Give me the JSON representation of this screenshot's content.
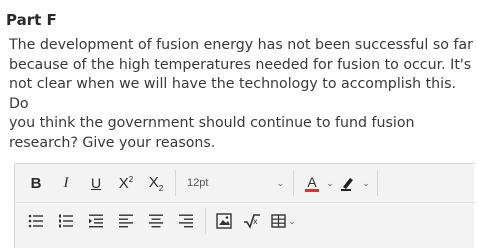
{
  "heading": "Part F",
  "question_lines": [
    "The development of fusion energy has not been successful so far",
    "because of the high temperatures needed for fusion to occur. It's",
    "not clear when we will have the technology to accomplish this. Do",
    "you think the government should continue to fund fusion",
    "research? Give your reasons."
  ],
  "toolbar": {
    "bold_label": "B",
    "italic_label": "I",
    "underline_label": "U",
    "superscript_label": "X",
    "superscript_mark": "2",
    "subscript_label": "X",
    "subscript_mark": "2",
    "font_size": "12pt",
    "text_color_label": "A",
    "text_color": "#d9342b",
    "icons_row1": [
      "bold-icon",
      "italic-icon",
      "underline-icon",
      "superscript-icon",
      "subscript-icon",
      "chevron-down-icon",
      "text-color-icon",
      "highlight-icon"
    ],
    "icons_row2": [
      "unordered-list-icon",
      "ordered-list-icon",
      "indent-icon",
      "align-left-icon",
      "align-center-icon",
      "align-right-icon",
      "image-icon",
      "equation-icon",
      "table-icon"
    ]
  }
}
